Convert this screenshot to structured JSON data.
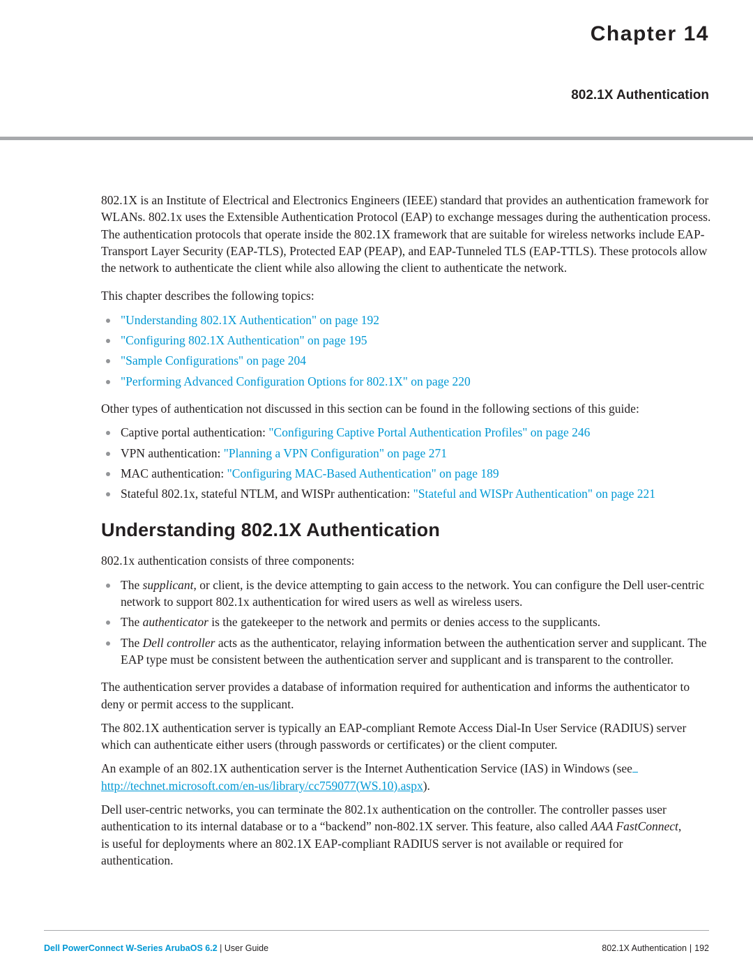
{
  "header": {
    "chapter_word": "Chapter",
    "chapter_number": "14",
    "subtitle": "802.1X Authentication"
  },
  "intro": {
    "paragraph": "802.1X is an Institute of Electrical and Electronics Engineers (IEEE) standard that provides an authentication framework for WLANs. 802.1x uses the Extensible Authentication Protocol (EAP) to exchange messages during the authentication process. The authentication protocols that operate inside the 802.1X framework that are suitable for wireless networks include EAP-Transport Layer Security (EAP-TLS), Protected EAP (PEAP), and EAP-Tunneled TLS (EAP-TTLS). These protocols allow the network to authenticate the client while also allowing the client to authenticate the network.",
    "topics_lead": "This chapter describes the following topics:",
    "topics": [
      "\"Understanding 802.1X Authentication\" on page 192",
      "\"Configuring 802.1X Authentication\" on page 195",
      "\"Sample Configurations\" on page 204",
      "\"Performing Advanced Configuration Options for 802.1X\" on page 220"
    ],
    "other_lead": "Other types of authentication not discussed in this section can be found in the following sections of this guide:",
    "other_items": [
      {
        "prefix": "Captive portal authentication: ",
        "link": "\"Configuring Captive Portal Authentication Profiles\" on page 246"
      },
      {
        "prefix": "VPN authentication: ",
        "link": "\"Planning a VPN Configuration\" on page 271"
      },
      {
        "prefix": "MAC authentication: ",
        "link": "\"Configuring MAC-Based Authentication\" on page 189"
      },
      {
        "prefix": "Stateful 802.1x, stateful NTLM, and WISPr authentication: ",
        "link": "\"Stateful and WISPr Authentication\" on page 221"
      }
    ]
  },
  "section": {
    "heading": "Understanding 802.1X Authentication",
    "lead": "802.1x authentication consists of three components:",
    "components": [
      {
        "pre": "The ",
        "italic": "supplicant",
        "post": ", or client, is the device attempting to gain access to the network. You can configure the Dell user-centric network to support 802.1x authentication for wired users as well as wireless users."
      },
      {
        "pre": "The ",
        "italic": "authenticator",
        "post": " is the gatekeeper to the network and permits or denies access to the supplicants."
      },
      {
        "pre": "The ",
        "italic": "Dell controller",
        "post": " acts as the authenticator, relaying information between the authentication server and supplicant. The EAP type must be consistent between the authentication server and supplicant and is transparent to the controller."
      }
    ],
    "para_server": "The authentication server provides a database of information required for authentication and informs the authenticator to deny or permit access to the supplicant.",
    "para_radius": "The 802.1X authentication server is typically an EAP-compliant Remote Access Dial-In User Service (RADIUS) server which can authenticate either users (through passwords or certificates) or the client computer.",
    "para_example_pre": "An example of an 802.1X authentication server is the Internet Authentication Service (IAS) in Windows (see",
    "para_example_url": "http://technet.microsoft.com/en-us/library/cc759077(WS.10).aspx",
    "para_example_post": ").",
    "para_fastconnect_pre": "Dell user-centric networks, you can terminate the 802.1x authentication on the controller. The controller passes user authentication to its internal database or to a “backend” non-802.1X server. This feature, also called ",
    "para_fastconnect_italic1": "AAA FastConnect",
    "para_fastconnect_post": ", is useful for deployments where an 802.1X EAP-compliant RADIUS server is not available or required for authentication."
  },
  "footer": {
    "brand": "Dell PowerConnect W-Series ArubaOS 6.2",
    "rest": " | User Guide",
    "right_title": "802.1X Authentication",
    "right_sep": "|",
    "right_page": "192"
  }
}
